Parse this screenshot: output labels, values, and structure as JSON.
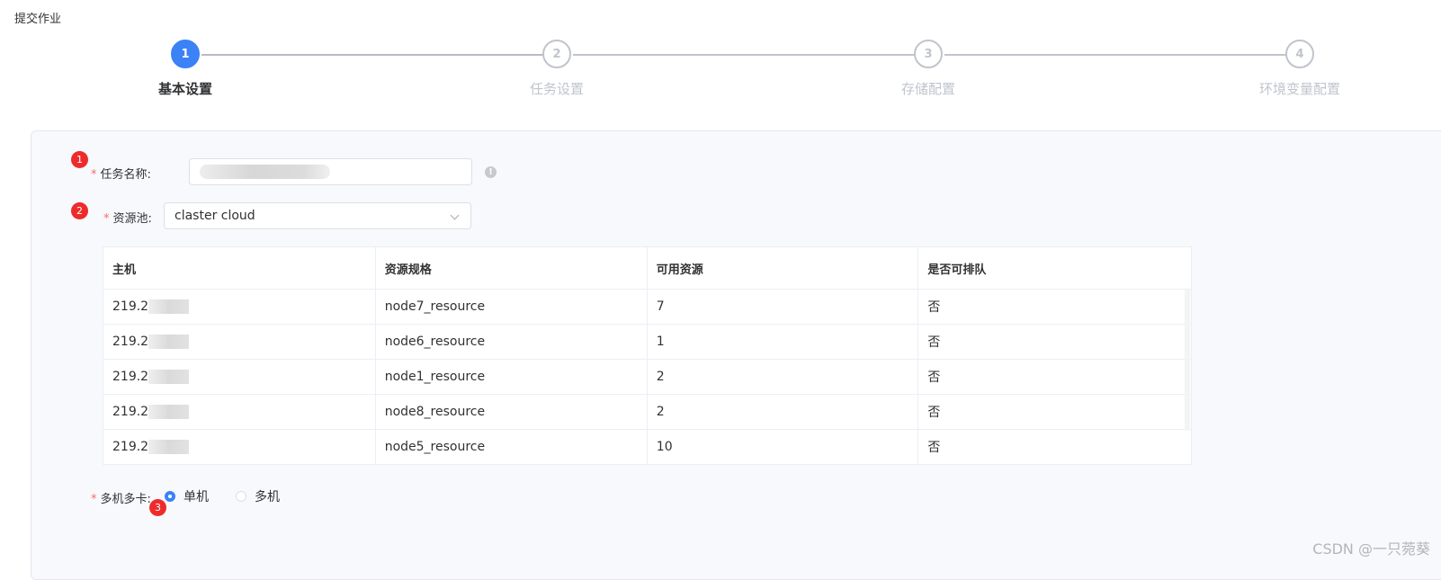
{
  "page": {
    "title": "提交作业"
  },
  "steps": [
    {
      "number": "1",
      "label": "基本设置",
      "active": true
    },
    {
      "number": "2",
      "label": "任务设置",
      "active": false
    },
    {
      "number": "3",
      "label": "存储配置",
      "active": false
    },
    {
      "number": "4",
      "label": "环境变量配置",
      "active": false
    }
  ],
  "markers": [
    "1",
    "2",
    "3"
  ],
  "form": {
    "required_mark": "*",
    "task_name": {
      "label": "任务名称:",
      "value": ""
    },
    "info_icon": "!",
    "resource_pool": {
      "label": "资源池:",
      "value": "claster cloud"
    },
    "multi_node": {
      "label": "多机多卡:",
      "options": [
        "单机",
        "多机"
      ],
      "selected": "单机"
    }
  },
  "table": {
    "columns": [
      "主机",
      "资源规格",
      "可用资源",
      "是否可排队"
    ],
    "rows": [
      [
        "219.2",
        "node7_resource",
        "7",
        "否"
      ],
      [
        "219.2",
        "node6_resource",
        "1",
        "否"
      ],
      [
        "219.2",
        "node1_resource",
        "2",
        "否"
      ],
      [
        "219.2",
        "node8_resource",
        "2",
        "否"
      ],
      [
        "219.2",
        "node5_resource",
        "10",
        "否"
      ]
    ]
  },
  "watermark": "CSDN @一只菀葵",
  "colors": {
    "primary": "#3b82f6",
    "marker": "#ee2b2b",
    "required": "#f56c6c"
  }
}
